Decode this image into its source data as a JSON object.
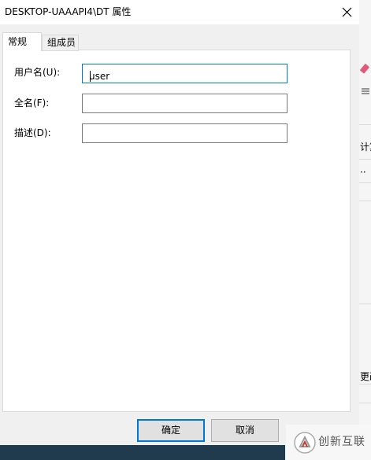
{
  "window": {
    "title": "DESKTOP-UAAAPI4\\DT 属性",
    "close_label": "×"
  },
  "tabs": [
    {
      "label": "常规",
      "active": true
    },
    {
      "label": "组成员",
      "active": false
    }
  ],
  "form": {
    "username_label": "用户名(U):",
    "username_value": "user",
    "fullname_label": "全名(F):",
    "fullname_value": "",
    "description_label": "描述(D):",
    "description_value": ""
  },
  "buttons": {
    "ok_label": "确定",
    "cancel_label": "取消"
  },
  "background": {
    "right_strip_texts": [
      "计算",
      "更改"
    ]
  },
  "watermark": {
    "text": "创新互联"
  }
}
